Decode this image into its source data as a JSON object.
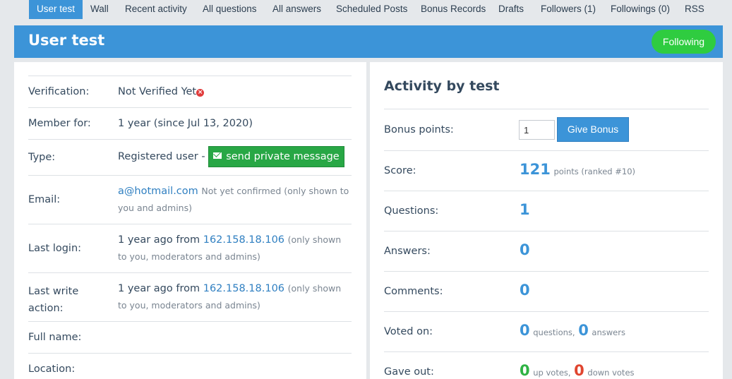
{
  "nav": {
    "tabs": [
      "User test",
      "Wall",
      "Recent activity",
      "All questions",
      "All answers",
      "Scheduled Posts",
      "Bonus Records",
      "Drafts",
      "Followers (1)",
      "Followings (0)",
      "RSS"
    ]
  },
  "header": {
    "title": "User test",
    "follow_label": "Following"
  },
  "profile": {
    "verification_label": "Verification:",
    "verification_value": "Not Verified Yet",
    "member_label": "Member for:",
    "member_value": "1 year (since Jul 13, 2020)",
    "type_label": "Type:",
    "type_value": "Registered user -",
    "pm_label": "send private message",
    "email_label": "Email:",
    "email_value": "a@hotmail.com",
    "email_note": "Not yet confirmed (only shown to you and admins)",
    "login_label": "Last login:",
    "login_prefix": "1 year ago from",
    "login_ip": "162.158.18.106",
    "login_note": "(only shown to you, moderators and admins)",
    "write_label_1": "Last write",
    "write_label_2": "action:",
    "write_prefix": "1 year ago from",
    "write_ip": "162.158.18.106",
    "write_note": "(only shown to you, moderators and admins)",
    "fullname_label": "Full name:",
    "location_label": "Location:"
  },
  "activity": {
    "title": "Activity by test",
    "bonus_label": "Bonus points:",
    "bonus_input_value": "1",
    "bonus_button": "Give Bonus",
    "score_label": "Score:",
    "score_value": "121",
    "score_note": "points (ranked #10)",
    "questions_label": "Questions:",
    "questions_value": "1",
    "answers_label": "Answers:",
    "answers_value": "0",
    "comments_label": "Comments:",
    "comments_value": "0",
    "voted_label": "Voted on:",
    "voted_q_value": "0",
    "voted_q_note": "questions,",
    "voted_a_value": "0",
    "voted_a_note": "answers",
    "gave_label": "Gave out:",
    "gave_up_value": "0",
    "gave_up_note": "up votes,",
    "gave_down_value": "0",
    "gave_down_note": "down votes"
  },
  "colors": {
    "accent": "#3c94d8",
    "follow_green": "#2fcc40",
    "pm_green": "#28a745",
    "down_red": "#e0452f"
  }
}
